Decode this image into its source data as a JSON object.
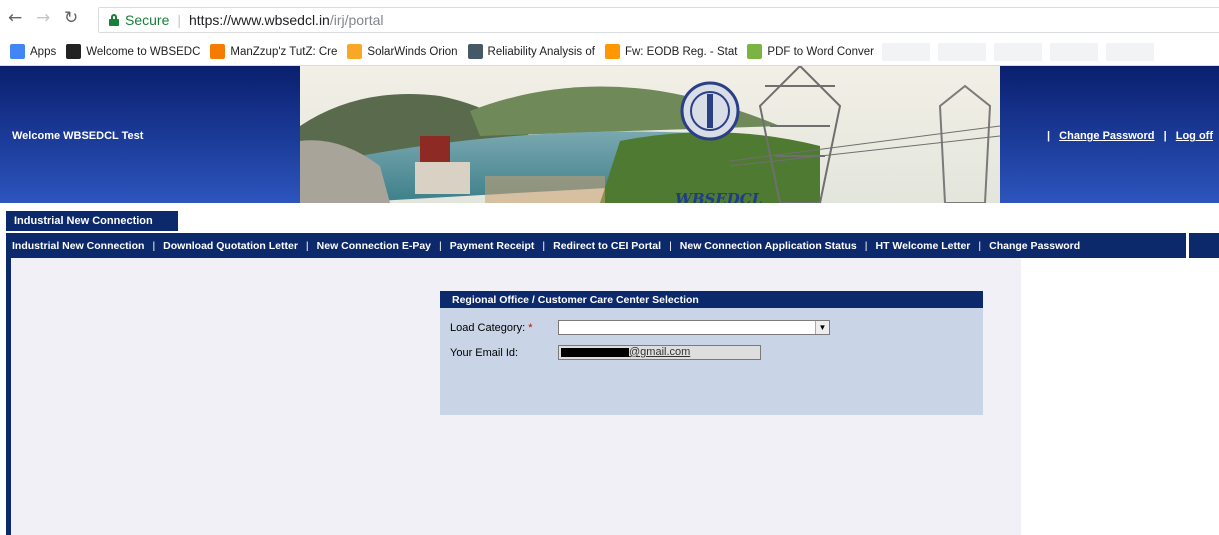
{
  "browser": {
    "secure_label": "Secure",
    "url_scheme": "https://",
    "url_host": "www.wbsedcl.in",
    "url_path": "/irj/portal",
    "bookmarks": [
      {
        "label": "Apps",
        "color": "#4285f4",
        "icon": "apps-grid-icon"
      },
      {
        "label": "Welcome to WBSEDC",
        "color": "#222222",
        "icon": "w-logo-icon"
      },
      {
        "label": "ManZzup'z TutZ: Cre",
        "color": "#f57c00",
        "icon": "blogger-icon"
      },
      {
        "label": "SolarWinds Orion",
        "color": "#f9a825",
        "icon": "solarwinds-icon"
      },
      {
        "label": "Reliability Analysis of",
        "color": "#455a64",
        "icon": "reliability-icon"
      },
      {
        "label": "Fw: EODB Reg. - Stat",
        "color": "#ff9800",
        "icon": "mail-circle-icon"
      },
      {
        "label": "PDF to Word Conver",
        "color": "#7cb342",
        "icon": "pdf-grid-icon"
      }
    ]
  },
  "header": {
    "welcome": "Welcome WBSEDCL Test",
    "logo_text": "WBSEDCL",
    "change_password": "Change Password",
    "log_off": "Log off",
    "pipe": "|"
  },
  "tab": {
    "label": "Industrial New Connection"
  },
  "menu": {
    "items": [
      "Industrial New Connection",
      "Download Quotation Letter",
      "New Connection E-Pay",
      "Payment Receipt",
      "Redirect to CEI Portal",
      "New Connection Application Status",
      "HT Welcome Letter",
      "Change Password"
    ],
    "separator": "|"
  },
  "form": {
    "title": "Regional Office / Customer Care Center Selection",
    "load_category_label": "Load Category:",
    "required_mark": "*",
    "load_category_value": "",
    "email_label": "Your Email Id:",
    "email_value": "@gmail.com"
  },
  "colors": {
    "navy": "#0c2a6b",
    "form_bg": "#c9d5e6",
    "content_bg": "#f0f0f6"
  }
}
